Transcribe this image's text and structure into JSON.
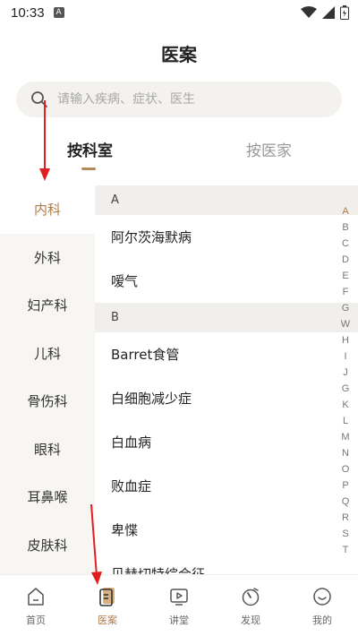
{
  "status_bar": {
    "time": "10:33",
    "indicator": "A"
  },
  "header": {
    "title": "医案"
  },
  "search": {
    "placeholder": "请输入疾病、症状、医生"
  },
  "tabs": [
    {
      "label": "按科室",
      "active": true
    },
    {
      "label": "按医家",
      "active": false
    }
  ],
  "departments": [
    {
      "label": "内科",
      "active": true
    },
    {
      "label": "外科"
    },
    {
      "label": "妇产科"
    },
    {
      "label": "儿科"
    },
    {
      "label": "骨伤科"
    },
    {
      "label": "眼科"
    },
    {
      "label": "耳鼻喉"
    },
    {
      "label": "皮肤科"
    }
  ],
  "disease_sections": [
    {
      "letter": "A",
      "items": [
        "阿尔茨海默病",
        "嗳气"
      ]
    },
    {
      "letter": "B",
      "items": [
        "Barret食管",
        "白细胞减少症",
        "白血病",
        "败血症",
        "卑惵",
        "贝赫切特综合征"
      ]
    }
  ],
  "alphabet_index": [
    "A",
    "B",
    "C",
    "D",
    "E",
    "F",
    "G",
    "W",
    "H",
    "I",
    "J",
    "G",
    "K",
    "L",
    "M",
    "N",
    "O",
    "P",
    "Q",
    "R",
    "S",
    "T"
  ],
  "bottom_nav": [
    {
      "label": "首页",
      "icon": "home-icon"
    },
    {
      "label": "医案",
      "icon": "book-icon",
      "active": true
    },
    {
      "label": "讲堂",
      "icon": "video-icon"
    },
    {
      "label": "发现",
      "icon": "compass-icon"
    },
    {
      "label": "我的",
      "icon": "smile-icon"
    }
  ],
  "colors": {
    "accent": "#b07b4a",
    "annotation": "#e02020"
  }
}
